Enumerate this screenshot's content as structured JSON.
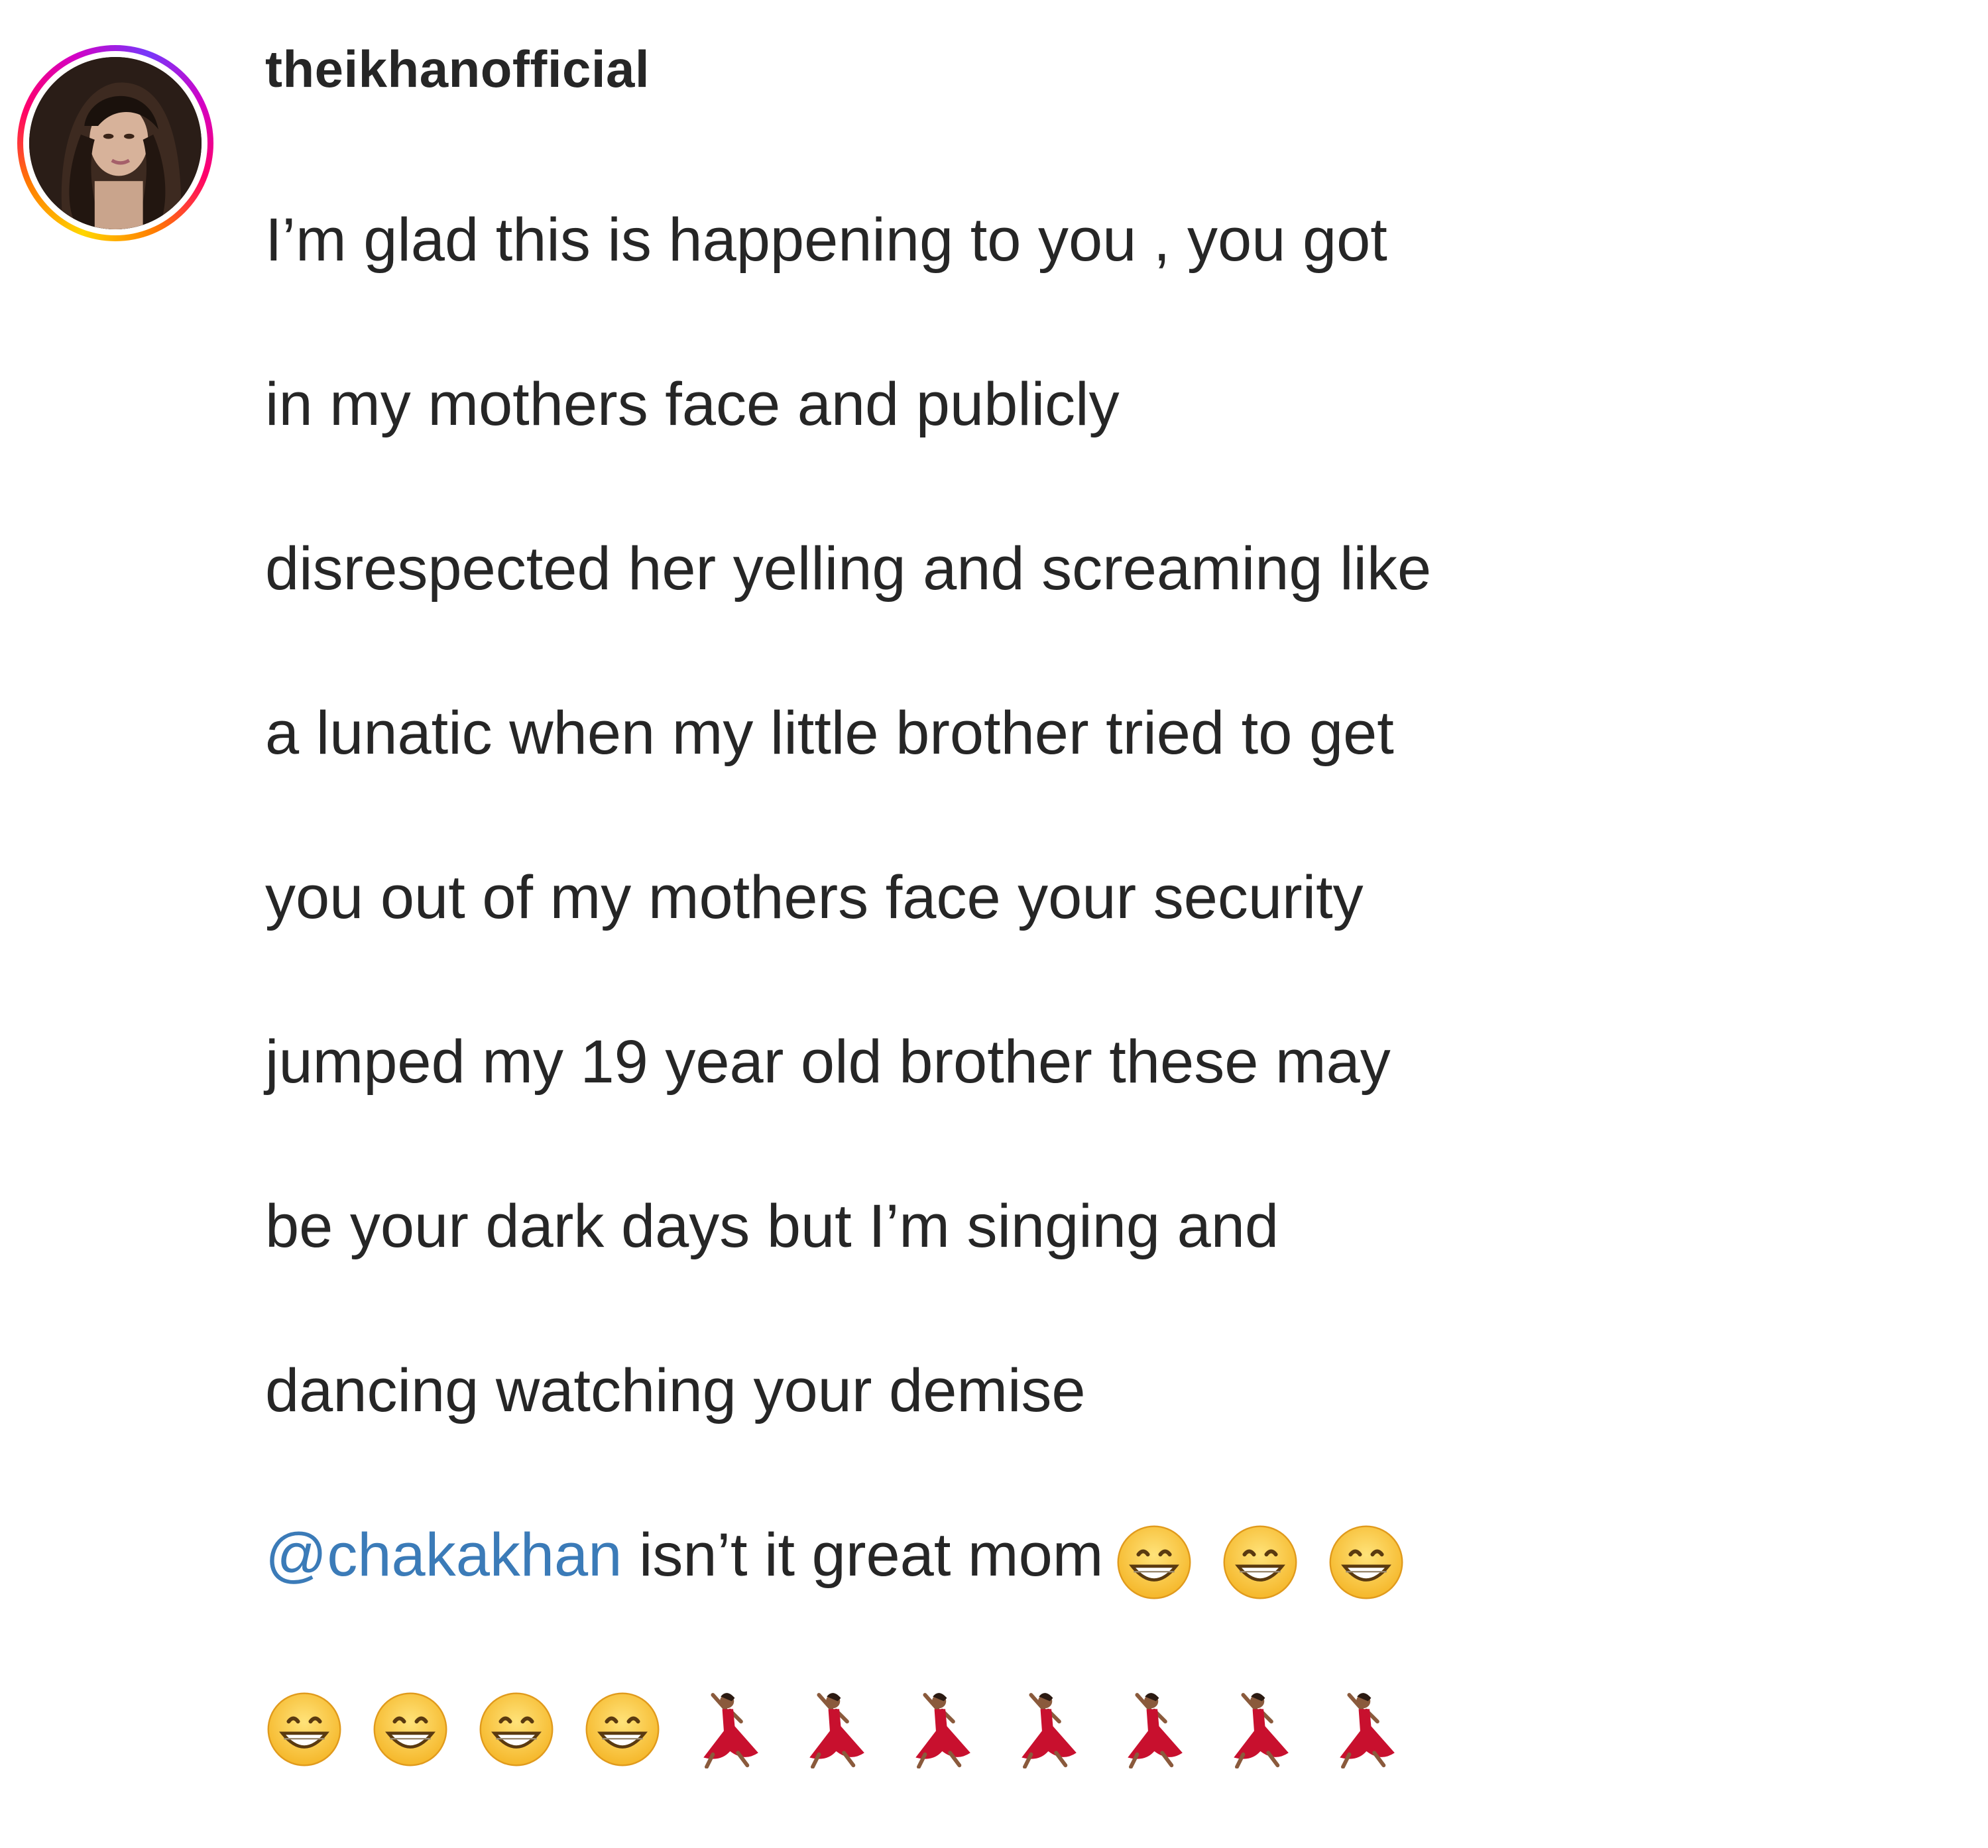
{
  "comment": {
    "username": "theikhanofficial",
    "lines": [
      "I’m glad this is happening to you , you got",
      "in my mothers face and publicly",
      "disrespected her yelling and screaming like",
      "a lunatic when my little brother tried to get",
      "you out of my mothers face your security",
      "jumped my 19 year old brother these may",
      "be your dark days but I’m singing and",
      "dancing watching your demise"
    ],
    "mention": "@chakakhan",
    "after_mention": " isn’t it great mom",
    "emojis": {
      "inline": [
        "grinning-face-icon",
        "grinning-face-icon",
        "grinning-face-icon"
      ],
      "row": [
        "grinning-face-icon",
        "grinning-face-icon",
        "grinning-face-icon",
        "grinning-face-icon",
        "dancer-icon",
        "dancer-icon",
        "dancer-icon",
        "dancer-icon",
        "dancer-icon",
        "dancer-icon",
        "dancer-icon"
      ]
    },
    "colors": {
      "text": "#262626",
      "mention": "#3b7bb8"
    }
  }
}
